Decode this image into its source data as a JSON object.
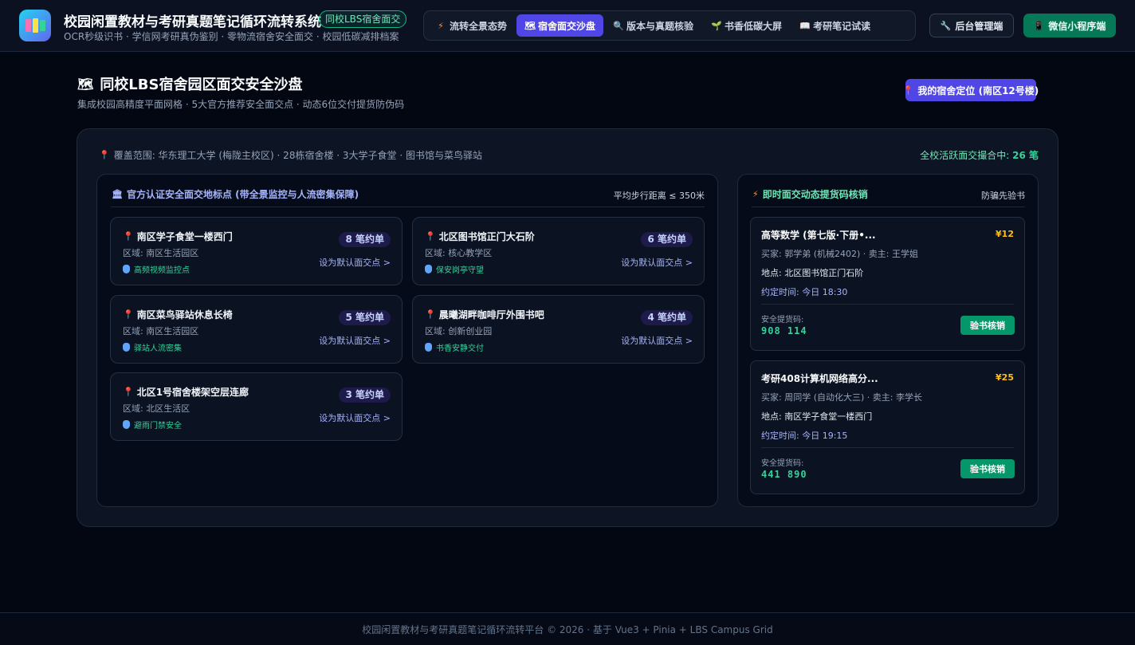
{
  "header": {
    "title": "校园闲置教材与考研真题笔记循环流转系统",
    "badge": "同校LBS宿舍面交",
    "subtitle": "OCR秒级识书 · 学信网考研真伪鉴别 · 零物流宿舍安全面交 · 校园低碳减排档案",
    "nav": [
      {
        "label": "流转全景态势",
        "icon": "⚡"
      },
      {
        "label": "宿舍面交沙盘",
        "icon": "🗺"
      },
      {
        "label": "版本与真题核验",
        "icon": "🔍"
      },
      {
        "label": "书香低碳大屏",
        "icon": "🌱"
      },
      {
        "label": "考研笔记试读",
        "icon": "📖"
      }
    ],
    "admin_label": "后台管理端",
    "wechat_label": "微信小程序端"
  },
  "page": {
    "title": "同校LBS宿舍园区面交安全沙盘",
    "subtitle": "集成校园高精度平面网格 · 5大官方推荐安全面交点 · 动态6位交付提货防伪码",
    "location_button": "我的宿舍定位 (南区12号楼)"
  },
  "coverage": {
    "label": "覆盖范围: 华东理工大学 (梅陇主校区) · 28栋宿舍楼 · 3大学子食堂 · 图书馆与菜鸟驿站",
    "active_prefix": "全校活跃面交撮合中:",
    "active_count": "26 笔"
  },
  "spots_section": {
    "title": "官方认证安全面交地标点 (带全景监控与人流密集保障)",
    "avg_distance": "平均步行距离 ≤ 350米",
    "spots": [
      {
        "name": "南区学子食堂一楼西门",
        "orders": "8 笔约单",
        "area": "区域: 南区生活园区",
        "tag": "高频视频监控点",
        "set_label": "设为默认面交点 >"
      },
      {
        "name": "北区图书馆正门大石阶",
        "orders": "6 笔约单",
        "area": "区域: 核心教学区",
        "tag": "保安岗亭守望",
        "set_label": "设为默认面交点 >"
      },
      {
        "name": "南区菜鸟驿站休息长椅",
        "orders": "5 笔约单",
        "area": "区域: 南区生活园区",
        "tag": "驿站人流密集",
        "set_label": "设为默认面交点 >"
      },
      {
        "name": "晨曦湖畔咖啡厅外围书吧",
        "orders": "4 笔约单",
        "area": "区域: 创新创业园",
        "tag": "书香安静交付",
        "set_label": "设为默认面交点 >"
      },
      {
        "name": "北区1号宿舍楼架空层连廊",
        "orders": "3 笔约单",
        "area": "区域: 北区生活区",
        "tag": "避雨门禁安全",
        "set_label": "设为默认面交点 >"
      }
    ]
  },
  "verify_section": {
    "title": "即时面交动态提货码核销",
    "right_label": "防骗先验书",
    "cards": [
      {
        "title": "高等数学 (第七版·下册•...",
        "price": "¥12",
        "parties": "买家: 郭学弟 (机械2402) · 卖主: 王学姐",
        "location": "地点: 北区图书馆正门石阶",
        "time": "约定时间: 今日 18:30",
        "code_label": "安全提货码:",
        "code": "908 114",
        "button": "验书核销"
      },
      {
        "title": "考研408计算机网络高分...",
        "price": "¥25",
        "parties": "买家: 周同学 (自动化大三) · 卖主: 李学长",
        "location": "地点: 南区学子食堂一楼西门",
        "time": "约定时间: 今日 19:15",
        "code_label": "安全提货码:",
        "code": "441 890",
        "button": "验书核销"
      }
    ]
  },
  "footer": "校园闲置教材与考研真题笔记循环流转平台 © 2026 · 基于 Vue3 + Pinia + LBS Campus Grid",
  "colors": {
    "accent": "#4f46e5",
    "success": "#059669",
    "price": "#fbbf24",
    "code": "#34d399"
  }
}
